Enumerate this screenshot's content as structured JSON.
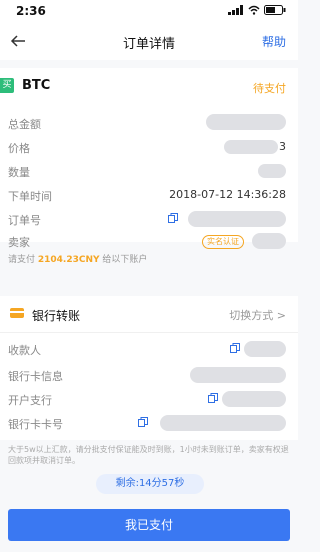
{
  "status_bar": {
    "time": "2:36"
  },
  "nav": {
    "title": "订单详情",
    "help": "帮助"
  },
  "coin": {
    "side_badge": "买",
    "symbol": "BTC",
    "status": "待支付"
  },
  "details": {
    "total_label": "总金额",
    "price_label": "价格",
    "price_tail": "3",
    "quantity_label": "数量",
    "order_time_label": "下单时间",
    "order_time": "2018-07-12 14:36:28",
    "order_no_label": "订单号",
    "seller_label": "卖家",
    "seller_verified": "实名认证"
  },
  "payment_note": {
    "prefix": "请支付 ",
    "amount": "2104.23CNY",
    "suffix": " 给以下账户"
  },
  "bank": {
    "title": "银行转账",
    "switch": "切换方式 >",
    "payee_label": "收款人",
    "bank_info_label": "银行卡信息",
    "branch_label": "开户支行",
    "card_no_label": "银行卡卡号"
  },
  "warning": "大于5w以上汇款，请分批支付保证能及时到账，1小时未到账订单，卖家有权退回款项并取消订单。",
  "countdown": "剩余:14分57秒",
  "paid_button": "我已支付"
}
